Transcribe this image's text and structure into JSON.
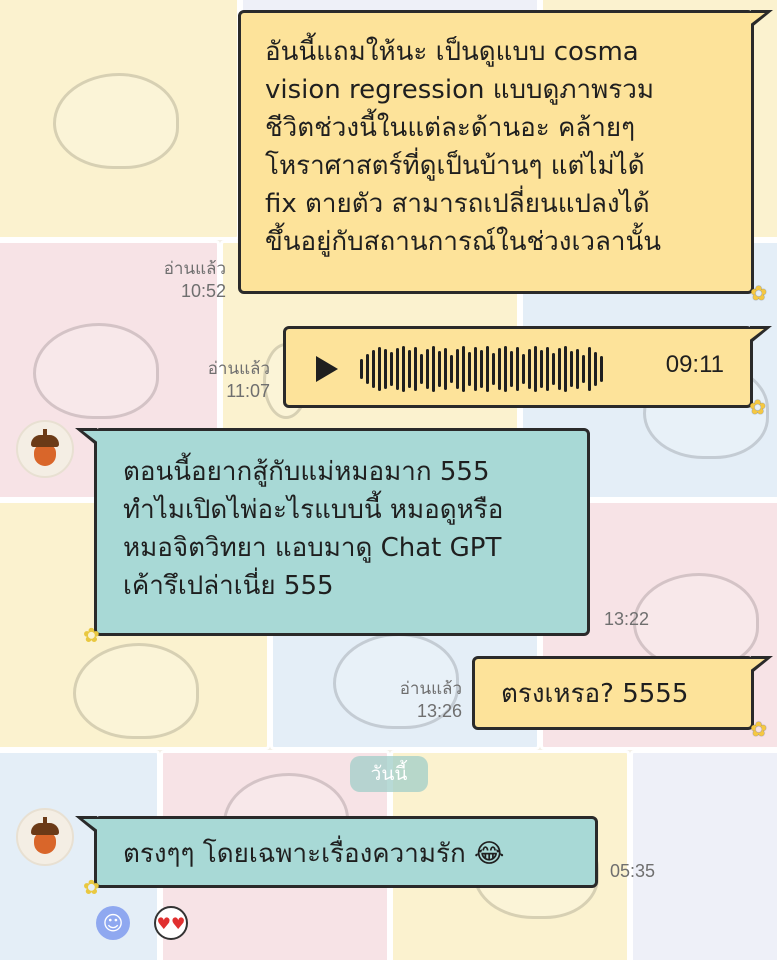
{
  "messages": {
    "m1": {
      "direction": "out",
      "text": "อันนี้แถมให้นะ เป็นดูแบบ cosma\nvision regression แบบดูภาพรวม\nชีวิตช่วงนี้ในแต่ละด้านอะ คล้ายๆ\nโหราศาสตร์ที่ดูเป็นบ้านๆ แต่ไม่ได้\nfix ตายตัว สามารถเปลี่ยนแปลงได้\nขึ้นอยู่กับสถานการณ์ในช่วงเวลานั้น",
      "read": "อ่านแล้ว",
      "time": "10:52"
    },
    "m2": {
      "direction": "out",
      "type": "voice",
      "duration": "09:11",
      "read": "อ่านแล้ว",
      "time": "11:07"
    },
    "m3": {
      "direction": "in",
      "text": "ตอนนี้อยากสู้กับแม่หมอมาก 555\nทำไมเปิดไพ่อะไรแบบนี้ หมอดูหรือ\nหมอจิตวิทยา แอบมาดู Chat GPT\nเค้ารึเปล่าเนี่ย 555",
      "time": "13:22"
    },
    "m4": {
      "direction": "out",
      "text": "ตรงเหรอ? 5555",
      "read": "อ่านแล้ว",
      "time": "13:26"
    },
    "m5": {
      "direction": "in",
      "text": "ตรงๆๆ โดยเฉพาะเรื่องความรัก 😂",
      "time": "05:35"
    }
  },
  "date_separator": "วันนี้",
  "colors": {
    "outgoing_bubble": "#fde39a",
    "incoming_bubble": "#a8d9d6",
    "outline": "#2a2a2a",
    "meta_text": "#6f6f6f"
  },
  "icons": {
    "avatar": "acorn-icon",
    "voice": "play-icon",
    "reactions": [
      "smiley-face-icon",
      "heart-eyes-face-icon"
    ]
  }
}
